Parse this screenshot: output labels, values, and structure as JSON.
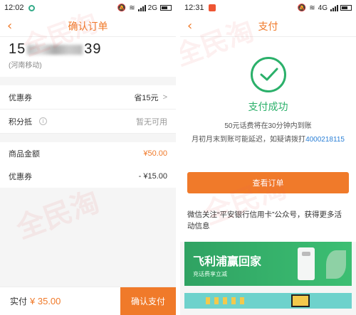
{
  "left": {
    "status": {
      "time": "12:02",
      "network": "2G"
    },
    "nav": {
      "back_icon": "‹",
      "title": "确认订单"
    },
    "phone": {
      "prefix": "15",
      "suffix": "39",
      "region": "(河南移动)"
    },
    "coupon": {
      "label": "优惠券",
      "value": "省15元"
    },
    "points": {
      "label": "积分抵",
      "value": "暂无可用"
    },
    "summary": {
      "goods_label": "商品金额",
      "goods_value": "¥50.00",
      "coupon_label": "优惠券",
      "coupon_value": "- ¥15.00"
    },
    "footer": {
      "pay_label": "实付",
      "pay_amount": "¥ 35.00",
      "confirm": "确认支付"
    }
  },
  "right": {
    "status": {
      "time": "12:31",
      "network": "4G"
    },
    "nav": {
      "back_icon": "‹",
      "title": "支付"
    },
    "success": {
      "title": "支付成功",
      "line1": "50元话费将在30分钟内到账",
      "line2_prefix": "月初月末到账可能延迟，如疑请拨打",
      "phone": "4000218115"
    },
    "view_order": "查看订单",
    "follow": "微信关注“平安银行信用卡”公众号，获得更多活动信息",
    "banner": {
      "title": "飞利浦赢回家",
      "subtitle": "充话费享立减"
    }
  },
  "watermark": "全民淘",
  "colors": {
    "accent": "#f07a2a",
    "success": "#2bb06a",
    "link": "#2a7fd6"
  }
}
